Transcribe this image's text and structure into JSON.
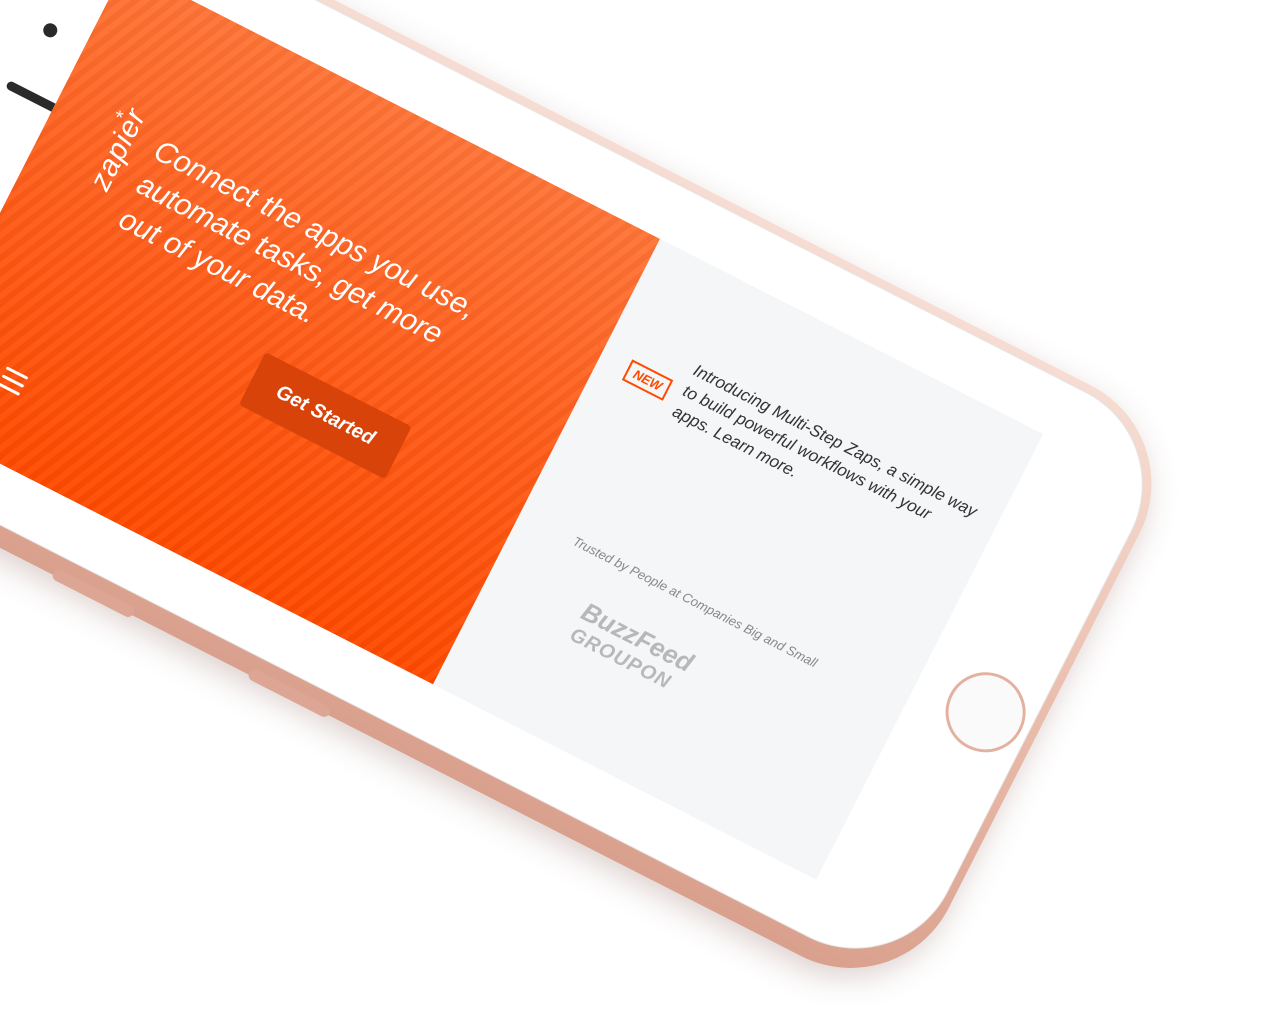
{
  "brand": {
    "logo_text": "zapier",
    "logo_mark": "*"
  },
  "hero": {
    "headline": "Connect the apps you use, automate tasks, get more out of your data.",
    "cta_label": "Get Started"
  },
  "announcement": {
    "badge": "NEW",
    "text": "Introducing Multi-Step Zaps, a simple way to build powerful workflows with your apps. Learn more."
  },
  "social_proof": {
    "trusted_text": "Trusted by People at Companies Big and Small",
    "logos": [
      "BuzzFeed",
      "GROUPON"
    ]
  },
  "colors": {
    "accent": "#ff4a00",
    "cta": "#d8430a",
    "device_rose_gold": "#e8b9a8"
  }
}
